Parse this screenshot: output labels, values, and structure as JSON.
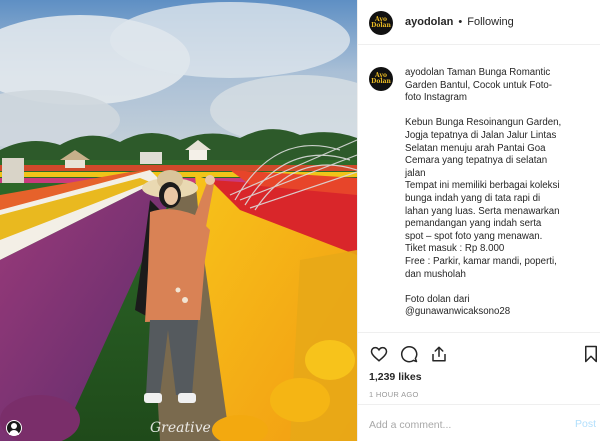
{
  "post": {
    "username": "ayodolan",
    "separator": "•",
    "follow_status": "Following",
    "avatar_text": "Ayo Dolan",
    "photo_credit": "Greative",
    "caption_lines_1": [
      "ayodolan Taman Bunga Romantic",
      "Garden Bantul, Cocok untuk Foto-",
      "foto Instagram"
    ],
    "caption_lines_2": [
      "Kebun Bunga Resoinangun Garden,",
      "Jogja tepatnya di Jalan Jalur Lintas",
      "Selatan menuju arah Pantai Goa",
      "Cemara yang tepatnya di selatan",
      "jalan",
      "Tempat ini memiliki berbagai koleksi",
      "bunga indah yang di tata rapi di",
      "lahan yang luas. Serta menawarkan",
      "pemandangan yang indah serta",
      "spot – spot foto yang menawan.",
      "Tiket masuk : Rp 8.000",
      "Free : Parkir, kamar mandi, poperti,",
      "dan musholah"
    ],
    "caption_lines_3": [
      "Foto dolan dari",
      "@gunawanwicaksono28"
    ],
    "likes": "1,239 likes",
    "time": "1 HOUR AGO"
  },
  "comment": {
    "placeholder": "Add a comment...",
    "post_label": "Post"
  },
  "icons": {
    "like": "heart-icon",
    "comment": "comment-bubble-icon",
    "share": "share-icon",
    "save": "bookmark-icon"
  },
  "colors": {
    "text": "#262626",
    "muted": "#999999",
    "post_link": "#b2dffc",
    "avatar_bg": "#111111",
    "avatar_logo": "#e8b923"
  }
}
